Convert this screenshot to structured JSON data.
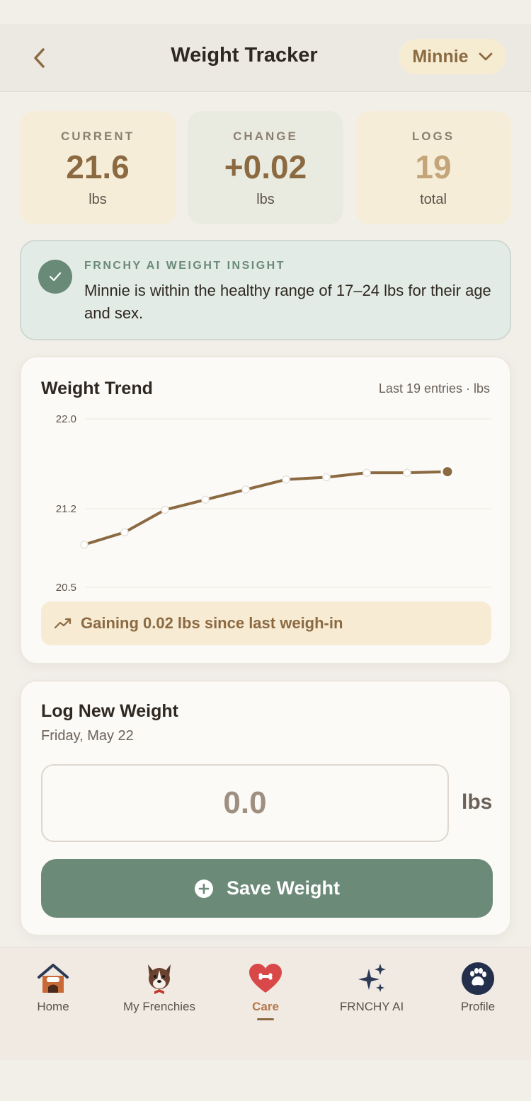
{
  "header": {
    "title": "Weight Tracker",
    "dog_selector": "Minnie"
  },
  "stats": [
    {
      "label": "CURRENT",
      "value": "21.6",
      "unit": "lbs"
    },
    {
      "label": "CHANGE",
      "value": "+0.02",
      "unit": "lbs"
    },
    {
      "label": "LOGS",
      "value": "19",
      "unit": "total"
    }
  ],
  "insight": {
    "title": "FRNCHY AI WEIGHT INSIGHT",
    "text": "Minnie is within the healthy range of 17–24 lbs for their age and sex."
  },
  "trend": {
    "title": "Weight Trend",
    "meta": "Last 19 entries · lbs",
    "note": "Gaining 0.02 lbs since last weigh-in"
  },
  "chart_data": {
    "type": "line",
    "y_ticks": [
      "22.0",
      "21.2",
      "20.5"
    ],
    "ylim": [
      20.5,
      22.0
    ],
    "values": [
      20.88,
      20.99,
      21.19,
      21.28,
      21.37,
      21.46,
      21.48,
      21.52,
      21.52,
      21.53
    ],
    "grid": true
  },
  "log": {
    "title": "Log New Weight",
    "date": "Friday, May 22",
    "input_placeholder": "0.0",
    "unit": "lbs",
    "save_label": "Save Weight"
  },
  "tabs": [
    {
      "label": "Home",
      "icon": "dog-house-icon"
    },
    {
      "label": "My Frenchies",
      "icon": "french-bulldog-icon"
    },
    {
      "label": "Care",
      "icon": "heart-bone-icon",
      "active": true
    },
    {
      "label": "FRNCHY AI",
      "icon": "sparkles-icon"
    },
    {
      "label": "Profile",
      "icon": "paw-avatar-icon"
    }
  ],
  "colors": {
    "accent_brown": "#8b6a42",
    "sage_green": "#6b8a77",
    "active_tab": "#b5784c"
  }
}
